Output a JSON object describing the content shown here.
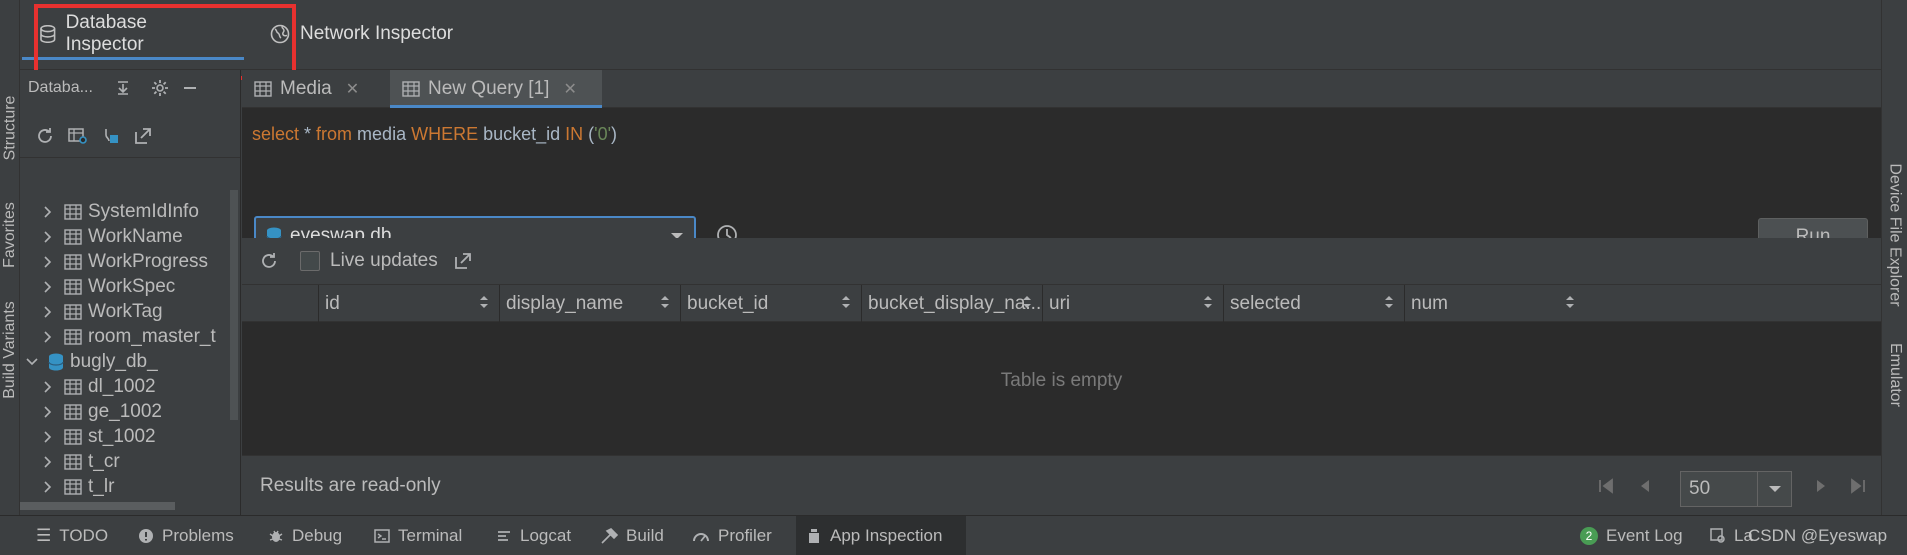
{
  "top_tabs": [
    {
      "label": "Database Inspector",
      "icon": "database-icon",
      "active": true
    },
    {
      "label": "Network Inspector",
      "icon": "globe-icon",
      "active": false
    }
  ],
  "left_strip": {
    "structure": "Structure",
    "favorites": "Favorites",
    "build_variants": "Build Variants"
  },
  "right_strip": {
    "device_file_explorer": "Device File Explorer",
    "emulator": "Emulator"
  },
  "tree": {
    "header": "Databa...",
    "rows": [
      {
        "label": "SystemIdInfo",
        "type": "table"
      },
      {
        "label": "WorkName",
        "type": "table"
      },
      {
        "label": "WorkProgress",
        "type": "table"
      },
      {
        "label": "WorkSpec",
        "type": "table"
      },
      {
        "label": "WorkTag",
        "type": "table"
      },
      {
        "label": "room_master_t",
        "type": "table"
      },
      {
        "label": "bugly_db_",
        "type": "database"
      },
      {
        "label": "dl_1002",
        "type": "table"
      },
      {
        "label": "ge_1002",
        "type": "table"
      },
      {
        "label": "st_1002",
        "type": "table"
      },
      {
        "label": "t_cr",
        "type": "table"
      },
      {
        "label": "t_lr",
        "type": "table"
      }
    ]
  },
  "editor_tabs": [
    {
      "label": "Media",
      "active": false
    },
    {
      "label": "New Query [1]",
      "active": true
    }
  ],
  "query": {
    "kw_select": "select",
    "star": " * ",
    "kw_from": "from",
    "table": " media ",
    "kw_where": "WHERE",
    "column": " bucket_id ",
    "kw_in": "IN",
    "paren_open": " (",
    "value": "'0'",
    "paren_close": ")"
  },
  "db_selector": {
    "value": "eyeswap.db"
  },
  "run_label": "Run",
  "live_updates_label": "Live updates",
  "columns": [
    "id",
    "display_name",
    "bucket_id",
    "bucket_display_na...",
    "uri",
    "selected",
    "num"
  ],
  "empty_message": "Table is empty",
  "readonly_label": "Results are read-only",
  "page_size": "50",
  "bottom_tabs": [
    {
      "label": "TODO",
      "icon": "list-icon"
    },
    {
      "label": "Problems",
      "icon": "info-icon"
    },
    {
      "label": "Debug",
      "icon": "bug-icon"
    },
    {
      "label": "Terminal",
      "icon": "terminal-icon"
    },
    {
      "label": "Logcat",
      "icon": "logcat-icon"
    },
    {
      "label": "Build",
      "icon": "hammer-icon"
    },
    {
      "label": "Profiler",
      "icon": "gauge-icon"
    },
    {
      "label": "App Inspection",
      "icon": "inspect-icon",
      "active": true
    }
  ],
  "event_log": {
    "label": "Event Log",
    "count": "2"
  },
  "layout_inspector_label": "La",
  "watermark": "CSDN @Eyeswap"
}
